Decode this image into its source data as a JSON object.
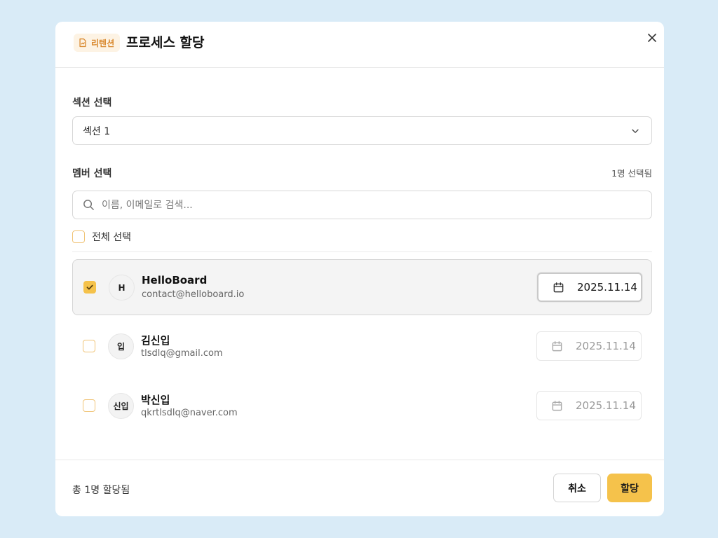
{
  "colors": {
    "page_bg": "#d9ebf7",
    "accent": "#f5c24b",
    "tag_bg": "#fdf3e4",
    "tag_text": "#d9892f"
  },
  "header": {
    "tag_label": "리텐션",
    "tag_icon": "document-icon",
    "title": "프로세스 할당",
    "close_icon": "close-icon"
  },
  "section": {
    "label": "섹션 선택",
    "selected_value": "섹션 1",
    "dropdown_icon": "chevron-down-icon"
  },
  "members": {
    "label": "멤버 선택",
    "selected_count": "1명 선택됨",
    "search_placeholder": "이름, 이메일로 검색...",
    "select_all_label": "전체 선택",
    "list": [
      {
        "avatar": "H",
        "name": "HelloBoard",
        "email": "contact@helloboard.io",
        "date": "2025.11.14",
        "checked": true
      },
      {
        "avatar": "입",
        "name": "김신입",
        "email": "tlsdlq@gmail.com",
        "date": "2025.11.14",
        "checked": false
      },
      {
        "avatar": "신입",
        "name": "박신입",
        "email": "qkrtlsdlq@naver.com",
        "date": "2025.11.14",
        "checked": false
      }
    ]
  },
  "footer": {
    "total_text": "총 1명 할당됨",
    "cancel_label": "취소",
    "assign_label": "할당"
  }
}
